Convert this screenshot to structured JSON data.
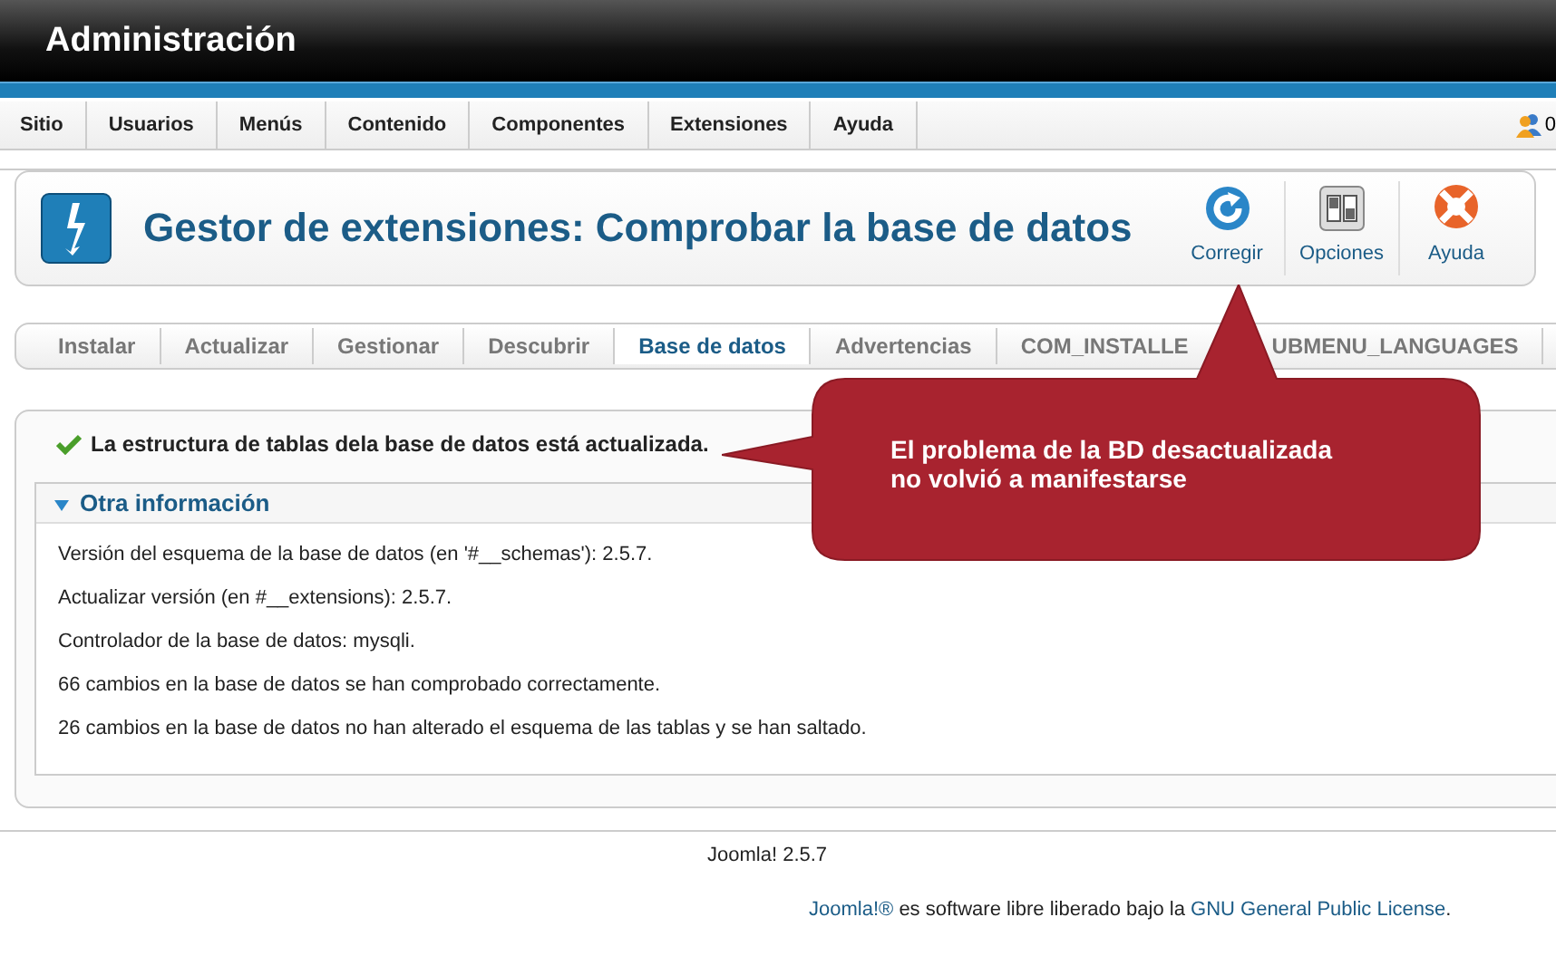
{
  "header": {
    "title": "Administración"
  },
  "menu": [
    {
      "label": "Sitio"
    },
    {
      "label": "Usuarios"
    },
    {
      "label": "Menús"
    },
    {
      "label": "Contenido"
    },
    {
      "label": "Componentes"
    },
    {
      "label": "Extensiones"
    },
    {
      "label": "Ayuda"
    }
  ],
  "status": {
    "count": "0"
  },
  "toolbar": {
    "title": "Gestor de extensiones: Comprobar la base de datos",
    "buttons": [
      {
        "kind": "refresh",
        "label": "Corregir"
      },
      {
        "kind": "options",
        "label": "Opciones"
      },
      {
        "kind": "help",
        "label": "Ayuda"
      }
    ]
  },
  "tabs": [
    {
      "label": "Instalar",
      "selected": false
    },
    {
      "label": "Actualizar",
      "selected": false
    },
    {
      "label": "Gestionar",
      "selected": false
    },
    {
      "label": "Descubrir",
      "selected": false
    },
    {
      "label": "Base de datos",
      "selected": true
    },
    {
      "label": "Advertencias",
      "selected": false
    },
    {
      "label": "COM_INSTALLE",
      "label_after": "UBMENU_LANGUAGES",
      "selected": false
    }
  ],
  "message": "La estructura de tablas dela base de datos está actualizada.",
  "other_info": {
    "title": "Otra información",
    "expanded": true,
    "lines": [
      "Versión del esquema de la base de datos (en '#__schemas'): 2.5.7.",
      "Actualizar versión (en #__extensions): 2.5.7.",
      "Controlador de la base de datos: mysqli.",
      "66 cambios en la base de datos se han comprobado correctamente.",
      "26 cambios en la base de datos no han alterado el esquema de las tablas y se han saltado."
    ]
  },
  "callout": {
    "lines": [
      "El problema de la BD desactualizada",
      "no volvió a manifestarse"
    ]
  },
  "footer": {
    "version": "Joomla! 2.5.7",
    "link1": "Joomla!®",
    "middle": "es software libre liberado bajo la",
    "link2": "GNU General Public License",
    "end": "."
  }
}
